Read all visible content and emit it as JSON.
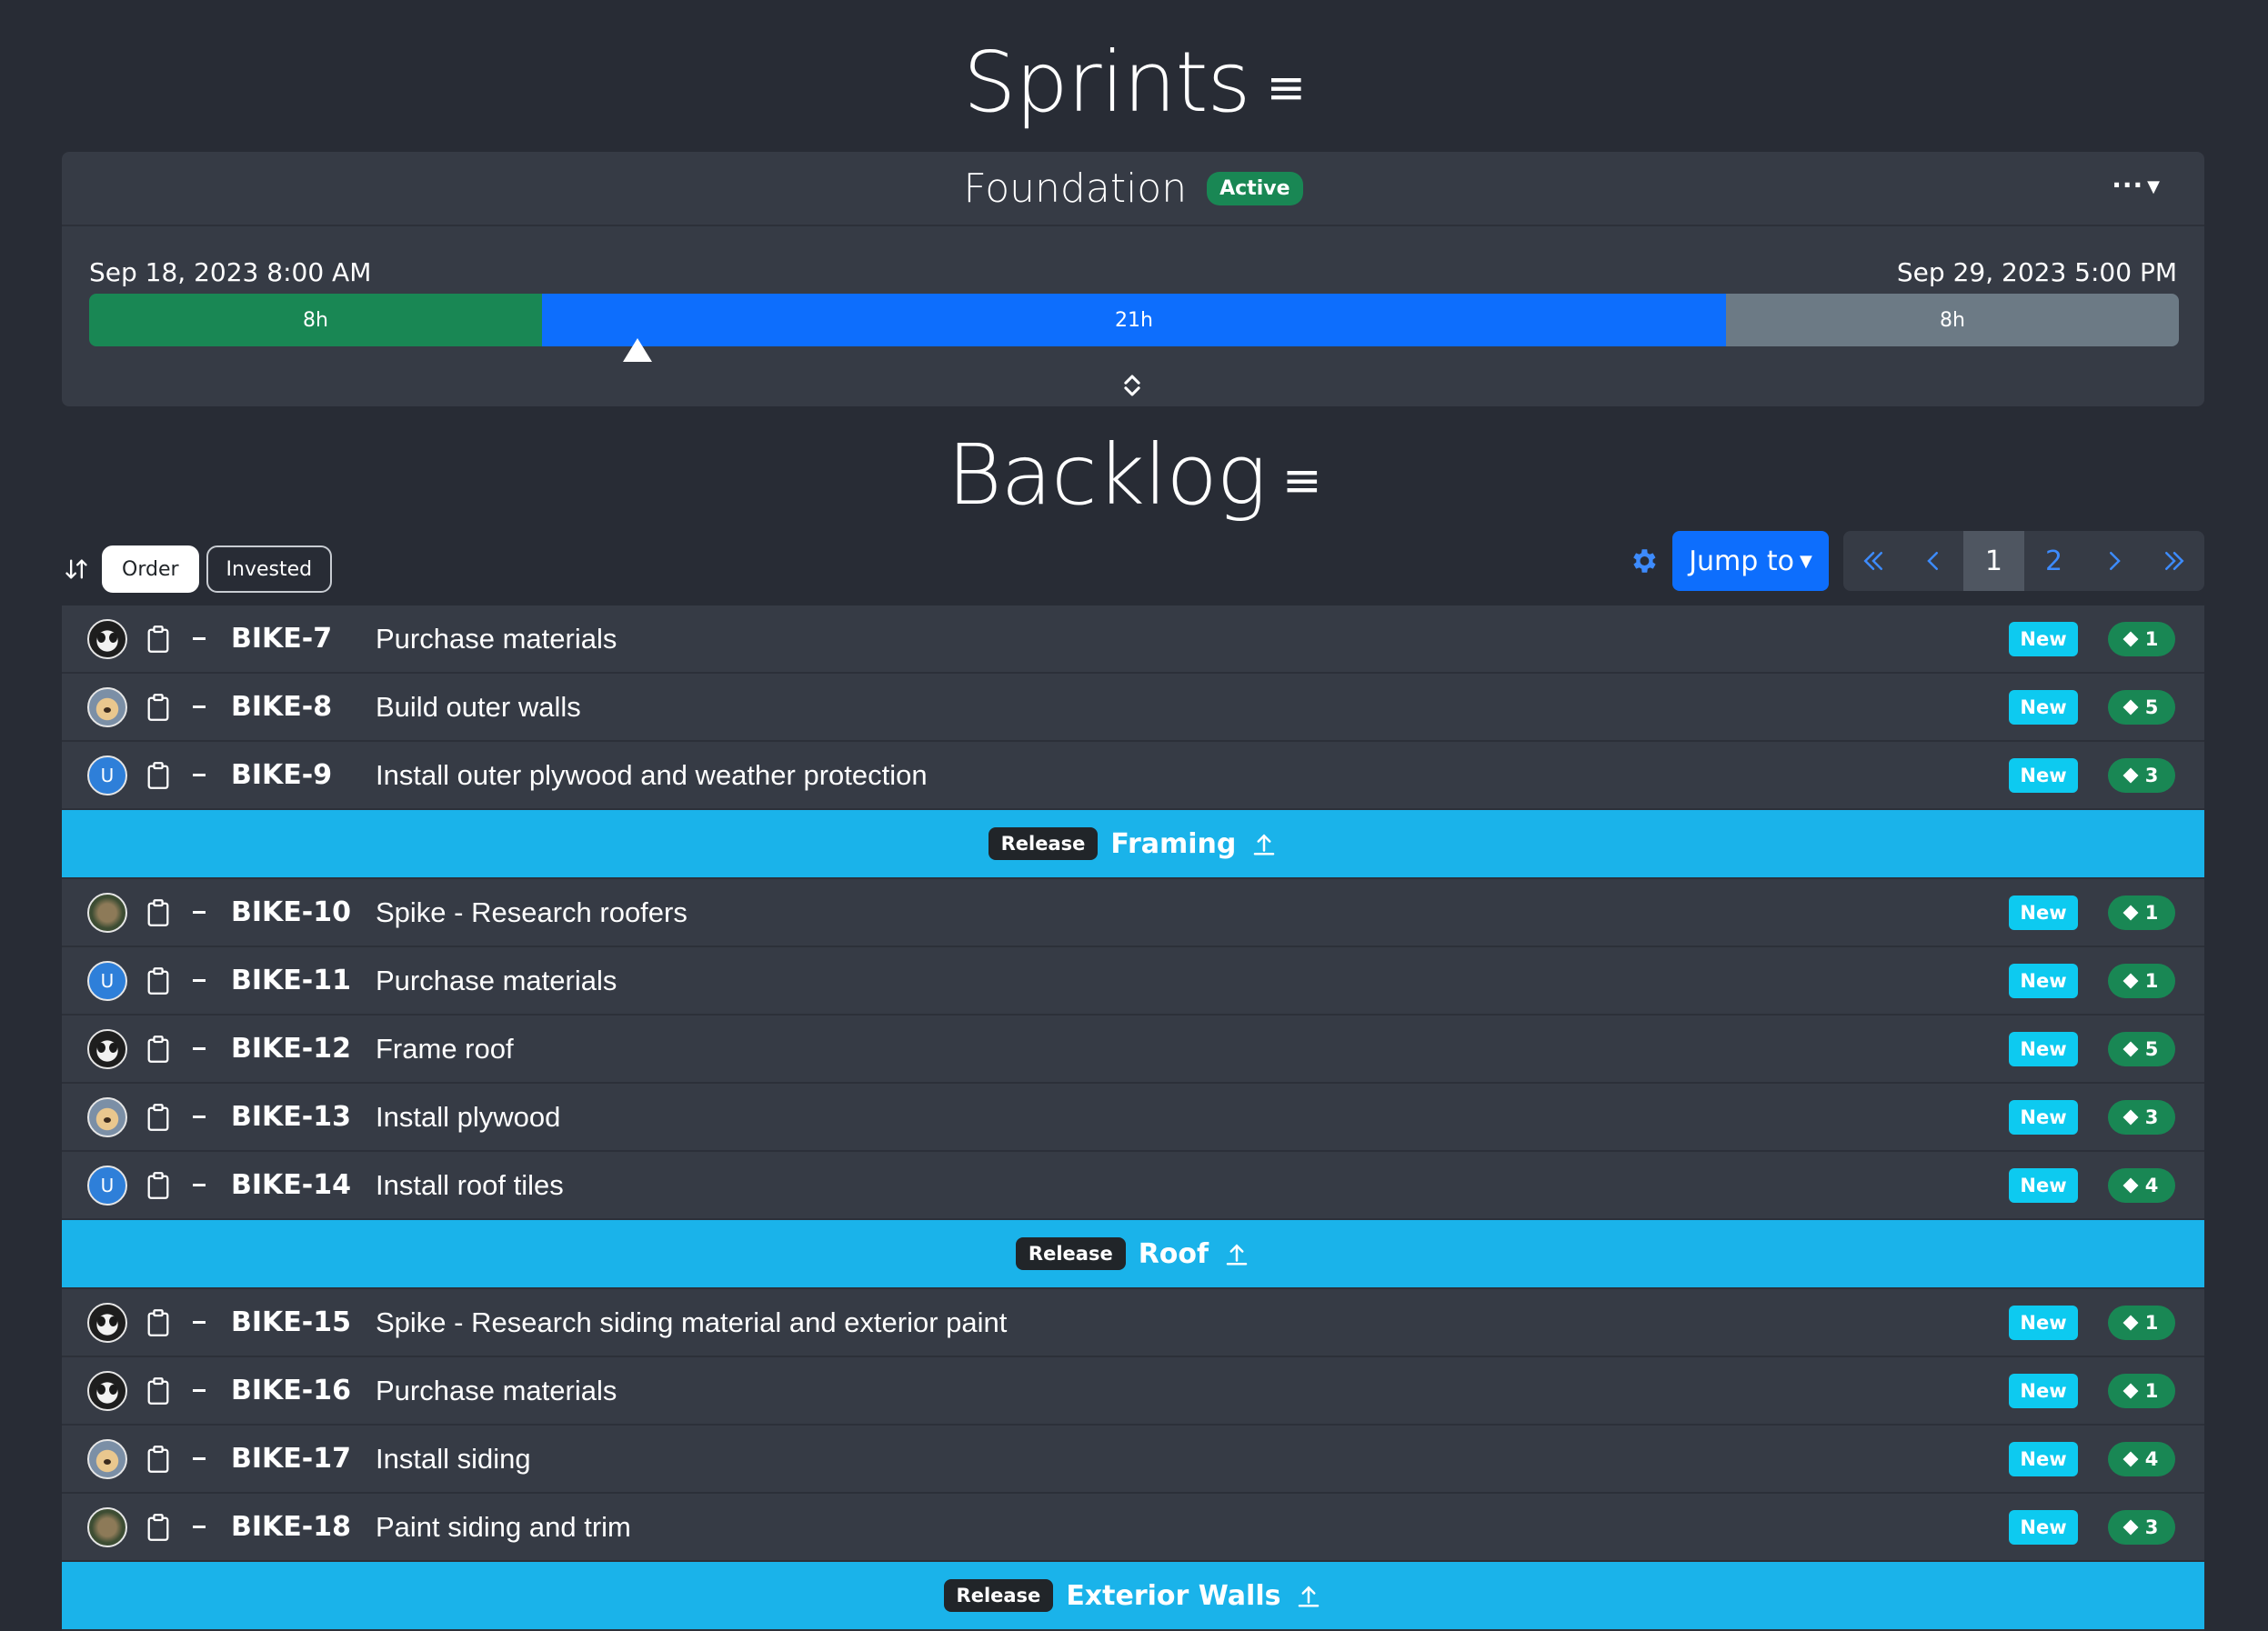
{
  "sprints": {
    "heading": "Sprints",
    "sprint": {
      "name": "Foundation",
      "status": "Active",
      "menu_label": "···",
      "start": "Sep 18, 2023 8:00 AM",
      "end": "Sep 29, 2023 5:00 PM",
      "progress": {
        "done": "8h",
        "in_progress": "21h",
        "remaining": "8h",
        "done_hours": 8,
        "in_progress_hours": 21,
        "remaining_hours": 8
      }
    }
  },
  "backlog": {
    "heading": "Backlog",
    "sort_buttons": [
      "Order",
      "Invested"
    ],
    "active_sort": "Order",
    "jump_label": "Jump to",
    "pages": [
      "1",
      "2"
    ],
    "current_page": "1"
  },
  "items": [
    {
      "kind": "item",
      "key": "BIKE-7",
      "title": "Purchase materials",
      "status": "New",
      "points": "1",
      "avatar": "panda"
    },
    {
      "kind": "item",
      "key": "BIKE-8",
      "title": "Build outer walls",
      "status": "New",
      "points": "5",
      "avatar": "dog"
    },
    {
      "kind": "item",
      "key": "BIKE-9",
      "title": "Install outer plywood and weather protection",
      "status": "New",
      "points": "3",
      "avatar": "U"
    },
    {
      "kind": "release",
      "label": "Release",
      "name": "Framing"
    },
    {
      "kind": "item",
      "key": "BIKE-10",
      "title": "Spike - Research roofers",
      "status": "New",
      "points": "1",
      "avatar": "cat"
    },
    {
      "kind": "item",
      "key": "BIKE-11",
      "title": "Purchase materials",
      "status": "New",
      "points": "1",
      "avatar": "U"
    },
    {
      "kind": "item",
      "key": "BIKE-12",
      "title": "Frame roof",
      "status": "New",
      "points": "5",
      "avatar": "panda"
    },
    {
      "kind": "item",
      "key": "BIKE-13",
      "title": "Install plywood",
      "status": "New",
      "points": "3",
      "avatar": "dog"
    },
    {
      "kind": "item",
      "key": "BIKE-14",
      "title": "Install roof tiles",
      "status": "New",
      "points": "4",
      "avatar": "U"
    },
    {
      "kind": "release",
      "label": "Release",
      "name": "Roof"
    },
    {
      "kind": "item",
      "key": "BIKE-15",
      "title": "Spike - Research siding material and exterior paint",
      "status": "New",
      "points": "1",
      "avatar": "panda"
    },
    {
      "kind": "item",
      "key": "BIKE-16",
      "title": "Purchase materials",
      "status": "New",
      "points": "1",
      "avatar": "panda"
    },
    {
      "kind": "item",
      "key": "BIKE-17",
      "title": "Install siding",
      "status": "New",
      "points": "4",
      "avatar": "dog"
    },
    {
      "kind": "item",
      "key": "BIKE-18",
      "title": "Paint siding and trim",
      "status": "New",
      "points": "3",
      "avatar": "cat"
    },
    {
      "kind": "release",
      "label": "Release",
      "name": "Exterior Walls"
    }
  ],
  "colors": {
    "background": "#282c35",
    "card": "#363b45",
    "done": "#198754",
    "in_progress": "#0d6efd",
    "remaining": "#6c7a85",
    "release": "#1ab3ea",
    "status_new": "#0dcaf0"
  }
}
